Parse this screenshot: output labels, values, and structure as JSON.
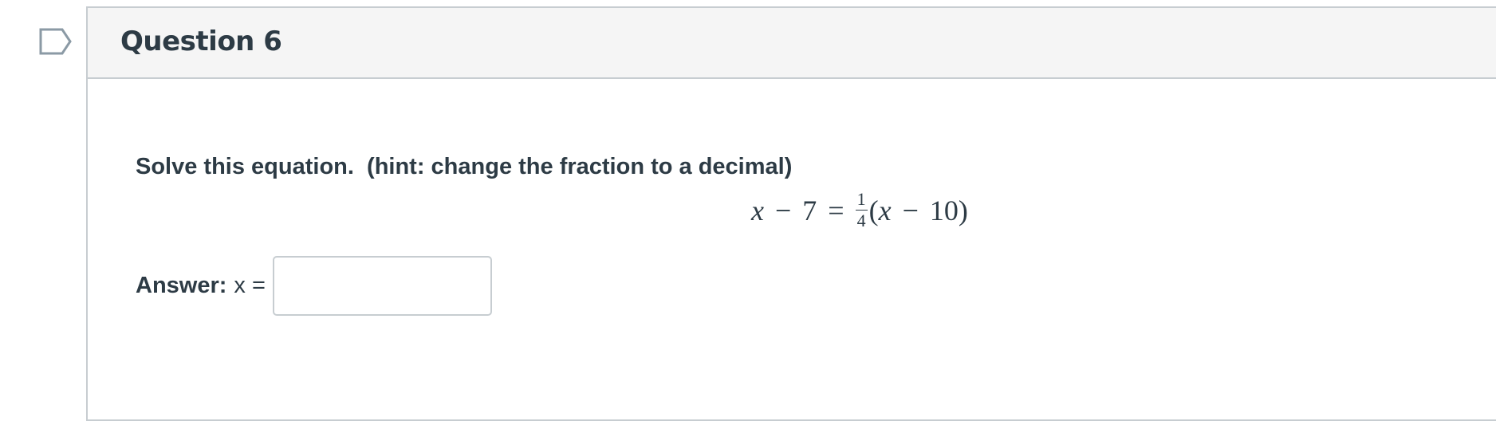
{
  "question": {
    "title": "Question 6",
    "prompt": "Solve this equation.  (hint: change the fraction to a decimal)",
    "equation": {
      "lhs_var": "x",
      "lhs_op": "−",
      "lhs_const": "7",
      "equals": "=",
      "frac_num": "1",
      "frac_den": "4",
      "open_paren": "(",
      "rhs_var": "x",
      "rhs_op": "−",
      "rhs_const": "10",
      "close_paren": ")"
    },
    "answer_label": "Answer:",
    "answer_var": "x =",
    "answer_value": "",
    "answer_placeholder": ""
  },
  "icons": {
    "flag": "flag-outline-icon"
  },
  "colors": {
    "text": "#2d3b45",
    "border": "#c7cdd1",
    "header_bg": "#f5f5f5",
    "flag_stroke": "#8b9aa5"
  }
}
